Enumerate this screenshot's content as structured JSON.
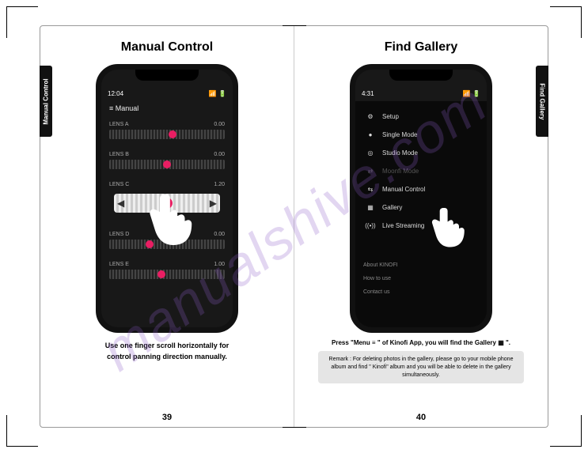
{
  "watermark": "manualshive.com",
  "cropmarks": true,
  "left_page": {
    "tab_label": "Manual Control",
    "title": "Manual Control",
    "status_time": "12:04",
    "screen_header": "≡  Manual",
    "sliders": [
      {
        "label": "LENS A",
        "value": "0.00",
        "knob_pct": 55
      },
      {
        "label": "LENS B",
        "value": "0.00",
        "knob_pct": 50
      },
      {
        "label": "LENS C",
        "value": "1.20",
        "knob_pct": 55,
        "highlighted": true
      },
      {
        "label": "LENS D",
        "value": "0.00",
        "knob_pct": 35
      },
      {
        "label": "LENS E",
        "value": "1.00",
        "knob_pct": 45
      }
    ],
    "caption_line1": "Use one finger scroll horizontally for",
    "caption_line2": "control panning direction manually.",
    "page_number": "39"
  },
  "right_page": {
    "tab_label": "Find Gallery",
    "title": "Find Gallery",
    "status_time": "4:31",
    "menu_items": [
      {
        "icon": "⚙",
        "label": "Setup",
        "dim": false
      },
      {
        "icon": "●",
        "label": "Single Mode",
        "dim": false
      },
      {
        "icon": "◎",
        "label": "Studio Mode",
        "dim": false
      },
      {
        "icon": "⇄",
        "label": "Moonfi Mode",
        "dim": true
      },
      {
        "icon": "⇆",
        "label": "Manual Control",
        "dim": false
      },
      {
        "icon": "▦",
        "label": "Gallery",
        "dim": false
      },
      {
        "icon": "((•))",
        "label": "Live Streaming",
        "dim": false
      }
    ],
    "footer_links": [
      "About KINOFI",
      "How to use",
      "Contact us"
    ],
    "instruction": "Press \"Menu  ≡ \" of Kinofi App, you will find the Gallery  ▦  \".",
    "remark": "Remark : For deleting photos in the gallery, please go to your mobile phone album and find \" Kinofi\" album and you will be able to delete in the gallery simultaneously.",
    "page_number": "40"
  }
}
